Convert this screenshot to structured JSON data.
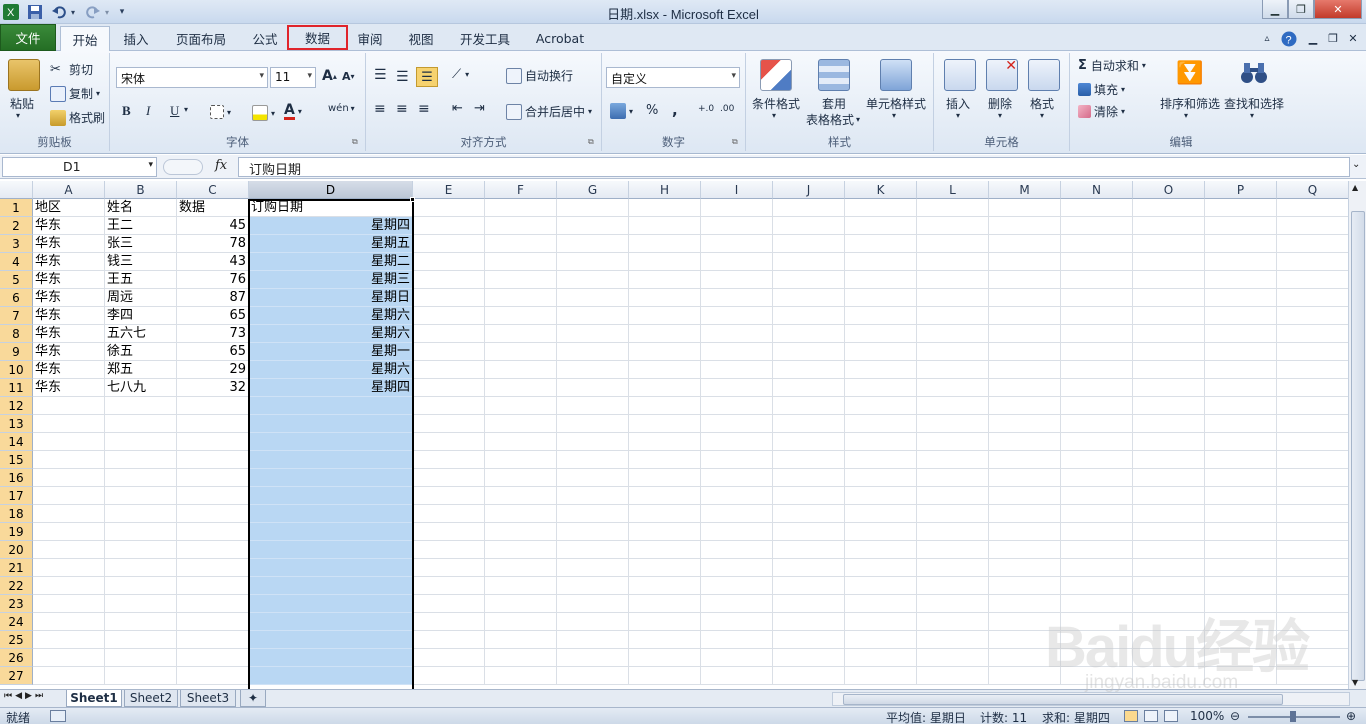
{
  "window": {
    "title": "日期.xlsx  -  Microsoft Excel"
  },
  "quick_access": {
    "excel_icon": "excel-icon",
    "save_icon": "save-icon",
    "undo_icon": "undo-icon",
    "redo_icon": "redo-icon",
    "customize_icon": "chevron-down-icon"
  },
  "tabs": [
    {
      "label": "文件"
    },
    {
      "label": "开始"
    },
    {
      "label": "插入"
    },
    {
      "label": "页面布局"
    },
    {
      "label": "公式"
    },
    {
      "label": "数据"
    },
    {
      "label": "审阅"
    },
    {
      "label": "视图"
    },
    {
      "label": "开发工具"
    },
    {
      "label": "Acrobat"
    }
  ],
  "active_tab": "开始",
  "highlighted_tab": "数据",
  "ribbon": {
    "clipboard": {
      "label": "剪贴板",
      "paste": "粘贴",
      "cut": "剪切",
      "copy": "复制",
      "format_painter": "格式刷"
    },
    "font": {
      "label": "字体",
      "font_name": "宋体",
      "font_size": "11",
      "bold": "B",
      "italic": "I",
      "underline": "U",
      "grow": "A",
      "shrink": "A",
      "phonetic": "wén"
    },
    "alignment": {
      "label": "对齐方式",
      "wrap": "自动换行",
      "merge": "合并后居中"
    },
    "number": {
      "label": "数字",
      "format": "自定义",
      "percent": "%",
      "comma": ",",
      "inc_decimal": "+.0",
      "dec_decimal": ".00"
    },
    "styles": {
      "label": "样式",
      "conditional": "条件格式",
      "as_table_1": "套用",
      "as_table_2": "表格格式",
      "cell_styles": "单元格样式"
    },
    "cells": {
      "label": "单元格",
      "insert": "插入",
      "delete": "删除",
      "format": "格式"
    },
    "editing": {
      "label": "编辑",
      "autosum": "自动求和",
      "fill": "填充",
      "clear": "清除",
      "sort_filter": "排序和筛选",
      "find_select": "查找和选择",
      "sigma": "Σ"
    }
  },
  "formula_bar": {
    "name_box": "D1",
    "fx": "fx",
    "content": "订购日期"
  },
  "columns": [
    "A",
    "B",
    "C",
    "D",
    "E",
    "F",
    "G",
    "H",
    "I",
    "J",
    "K",
    "L",
    "M",
    "N",
    "O",
    "P",
    "Q"
  ],
  "rows": [
    "1",
    "2",
    "3",
    "4",
    "5",
    "6",
    "7",
    "8",
    "9",
    "10",
    "11",
    "12",
    "13",
    "14",
    "15",
    "16",
    "17",
    "18",
    "19",
    "20",
    "21",
    "22",
    "23",
    "24",
    "25",
    "26",
    "27"
  ],
  "headers": [
    "地区",
    "姓名",
    "数据",
    "订购日期"
  ],
  "data_rows": [
    [
      "华东",
      "王二",
      "45",
      "星期四"
    ],
    [
      "华东",
      "张三",
      "78",
      "星期五"
    ],
    [
      "华东",
      "钱三",
      "43",
      "星期二"
    ],
    [
      "华东",
      "王五",
      "76",
      "星期三"
    ],
    [
      "华东",
      "周远",
      "87",
      "星期日"
    ],
    [
      "华东",
      "李四",
      "65",
      "星期六"
    ],
    [
      "华东",
      "五六七",
      "73",
      "星期六"
    ],
    [
      "华东",
      "徐五",
      "65",
      "星期一"
    ],
    [
      "华东",
      "郑五",
      "29",
      "星期六"
    ],
    [
      "华东",
      "七八九",
      "32",
      "星期四"
    ]
  ],
  "sheets": [
    "Sheet1",
    "Sheet2",
    "Sheet3"
  ],
  "active_sheet": "Sheet1",
  "status": {
    "ready": "就绪",
    "average": "平均值: 星期日",
    "count": "计数: 11",
    "sum": "求和: 星期四",
    "zoom": "100%"
  },
  "watermark": {
    "brand": "Baidu经验",
    "url": "jingyan.baidu.com"
  },
  "colors": {
    "file_tab": "#2a7a2a",
    "selection": "#b9d7f3",
    "highlight_box": "#e0242b",
    "row_header_selected": "#f9d99a"
  }
}
